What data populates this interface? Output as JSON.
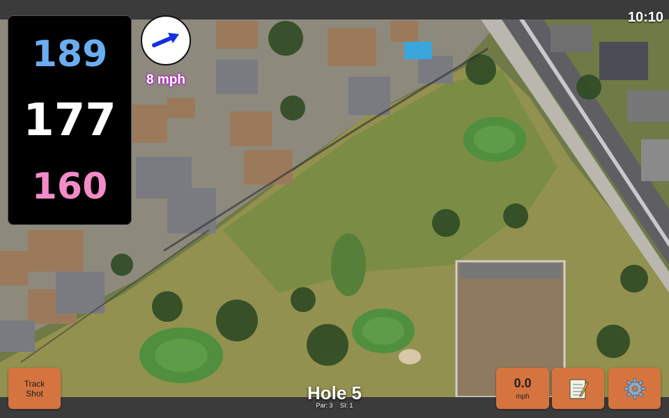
{
  "status": {
    "time": "10:10"
  },
  "yardages": {
    "back": "189",
    "middle": "177",
    "front": "160"
  },
  "wind": {
    "speed_label": "8 mph",
    "icon": "wind-arrow-icon"
  },
  "controls": {
    "track_shot_line1": "Track",
    "track_shot_line2": "Shot",
    "speed_value": "0.0",
    "speed_unit": "mph",
    "notes_icon": "notepad-icon",
    "settings_icon": "gear-icon"
  },
  "hole": {
    "title": "Hole 5",
    "par": "Par: 3",
    "si": "SI: 1"
  },
  "colors": {
    "back": "#6aaef1",
    "middle": "#ffffff",
    "front": "#f48bc9",
    "button": "#d6743f",
    "bar": "#3b3b3b"
  }
}
